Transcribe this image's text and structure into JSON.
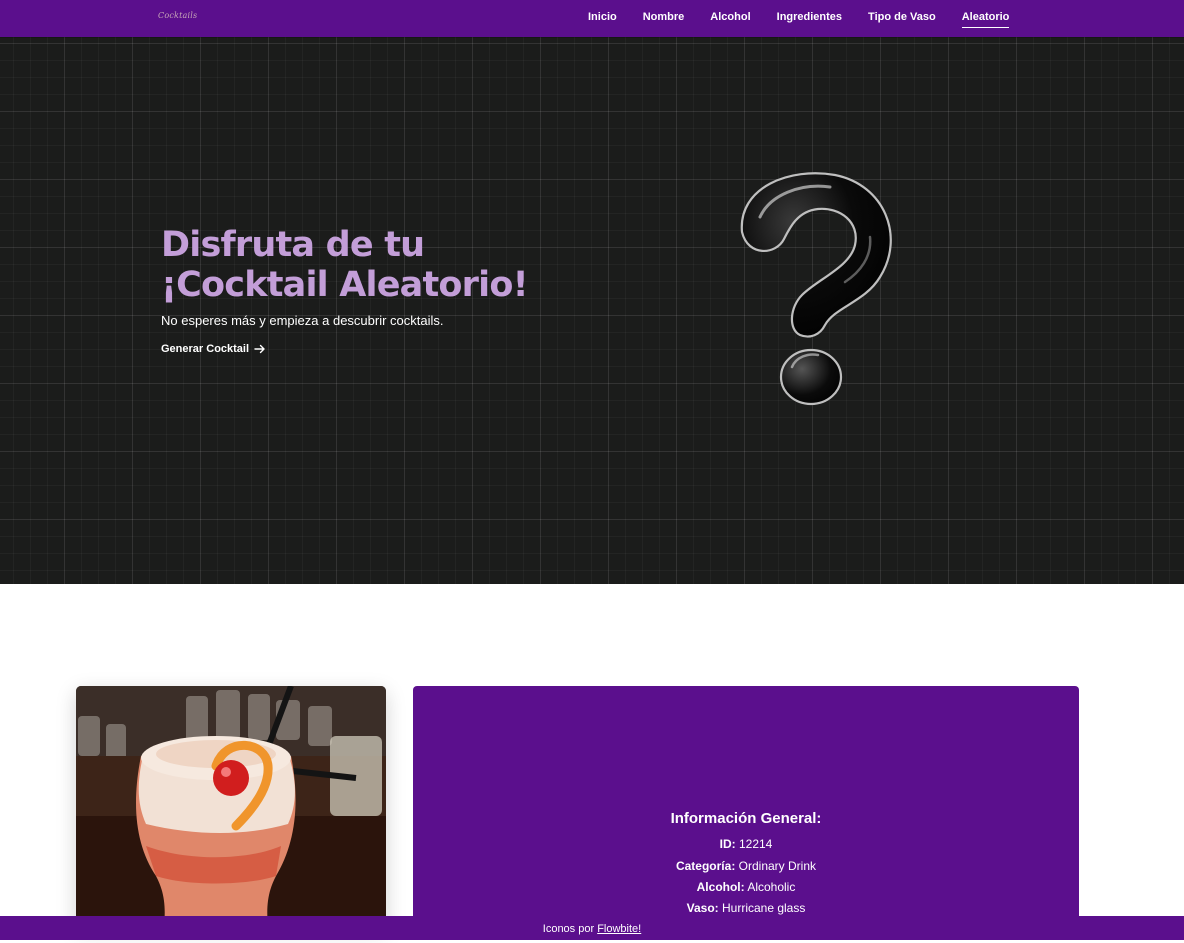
{
  "nav": {
    "logo": "Cocktails",
    "links": [
      "Inicio",
      "Nombre",
      "Alcohol",
      "Ingredientes",
      "Tipo de Vaso",
      "Aleatorio"
    ],
    "active": "Aleatorio"
  },
  "hero": {
    "title_line1": "Disfruta de tu",
    "title_line2": "¡Cocktail Aleatorio!",
    "subtitle": "No esperes más y empieza a descubrir cocktails.",
    "cta_label": "Generar Cocktail"
  },
  "info": {
    "heading": "Información General:",
    "rows": [
      {
        "label": "ID:",
        "value": "12214"
      },
      {
        "label": "Categoría:",
        "value": "Ordinary Drink"
      },
      {
        "label": "Alcohol:",
        "value": "Alcoholic"
      },
      {
        "label": "Vaso:",
        "value": "Hurricane glass"
      }
    ]
  },
  "footer": {
    "text": "Iconos por",
    "link": "Flowbite!"
  },
  "icons": {
    "cta": "arrow-right-icon",
    "hero_art": "question-mark-icon"
  },
  "colors": {
    "brand_purple": "#5b0f8d",
    "hero_title": "#c39ed8",
    "hero_bg": "#1b1c1b"
  }
}
